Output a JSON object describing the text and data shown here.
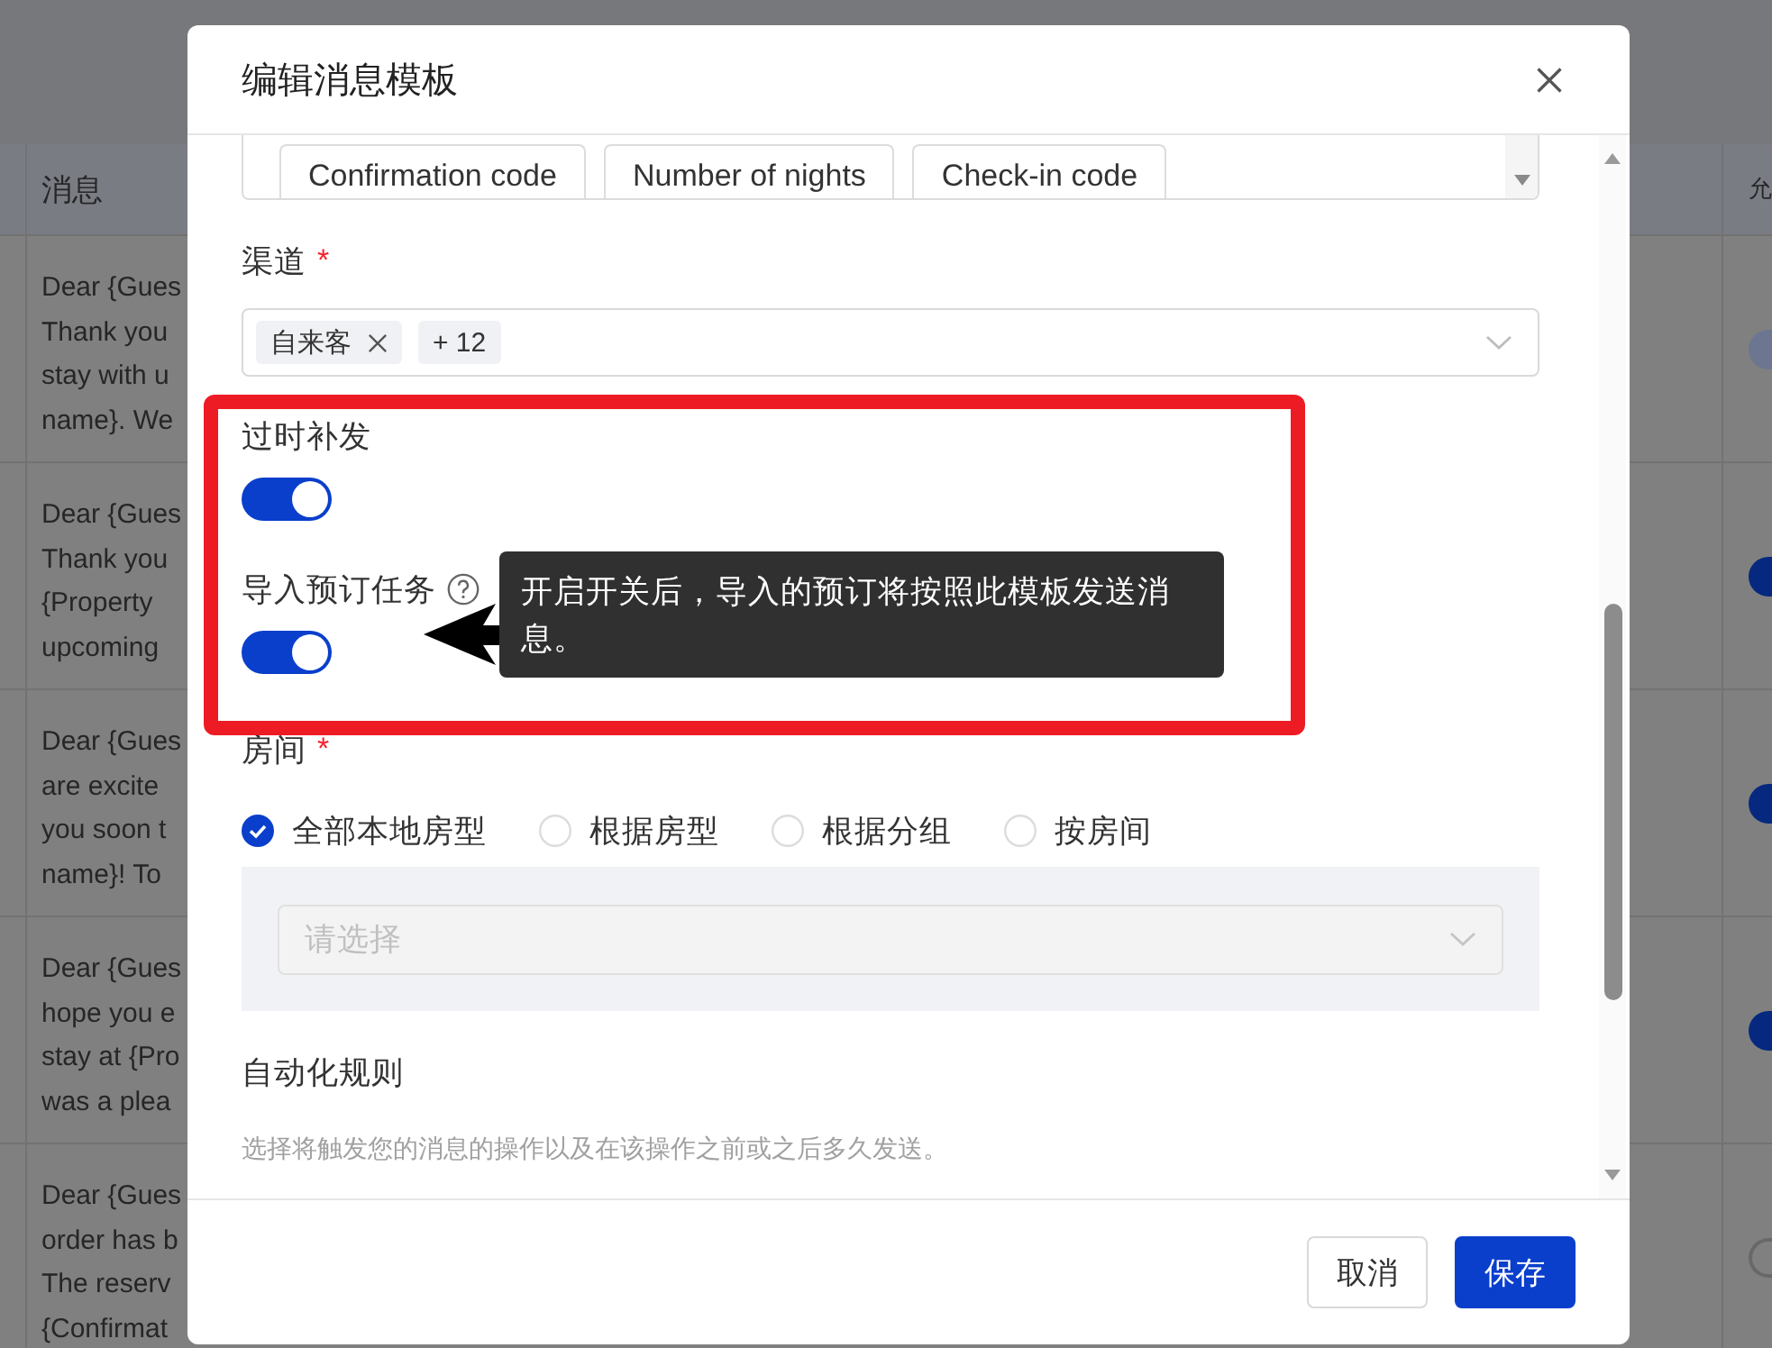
{
  "background": {
    "table": {
      "columns": [
        {
          "label": "消息"
        },
        {
          "label": "允"
        }
      ],
      "rows": [
        {
          "message": "Dear {Gues\nThank you\nstay with u\nname}. We",
          "switch": {
            "on": true,
            "disabled": true
          }
        },
        {
          "message": "Dear {Gues\nThank you\n{Property\nupcoming",
          "switch": {
            "on": true,
            "disabled": false
          }
        },
        {
          "message": "Dear {Gues\nare excite\nyou soon t\nname}! To",
          "switch": {
            "on": true,
            "disabled": false
          }
        },
        {
          "message": "Dear {Gues\nhope you e\nstay at {Pro\nwas a plea",
          "switch": {
            "on": true,
            "disabled": false
          }
        },
        {
          "message": "Dear {Gues\norder has b\nThe reserv\n{Confirmat",
          "switch": {
            "on": false,
            "disabled": false
          }
        }
      ]
    }
  },
  "dialog": {
    "title": "编辑消息模板",
    "variables": [
      {
        "label": "Confirmation code"
      },
      {
        "label": "Number of nights"
      },
      {
        "label": "Check-in code"
      }
    ],
    "channel": {
      "label": "渠道",
      "required_mark": "*",
      "tags": [
        {
          "label": "自来客"
        }
      ],
      "more": "+ 12"
    },
    "switches": [
      {
        "label": "过时补发",
        "on": true,
        "help": false
      },
      {
        "label": "导入预订任务",
        "on": true,
        "help": true
      }
    ],
    "tooltip": {
      "text": "开启开关后，导入的预订将按照此模板发送消息。"
    },
    "room": {
      "label": "房间",
      "required_mark": "*",
      "options": [
        {
          "label": "全部本地房型",
          "selected": true
        },
        {
          "label": "根据房型",
          "selected": false
        },
        {
          "label": "根据分组",
          "selected": false
        },
        {
          "label": "按房间",
          "selected": false
        }
      ],
      "select": {
        "placeholder": "请选择",
        "disabled": true
      }
    },
    "automation": {
      "label": "自动化规则",
      "hint": "选择将触发您的消息的操作以及在该操作之前或之后多久发送。"
    },
    "buttons": [
      {
        "label": "取消",
        "kind": "default"
      },
      {
        "label": "保存",
        "kind": "primary"
      }
    ]
  }
}
